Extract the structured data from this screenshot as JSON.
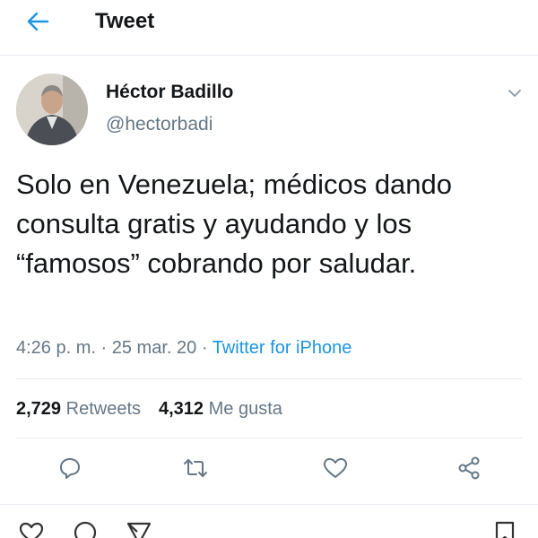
{
  "header": {
    "back_icon": "arrow-left-icon",
    "title": "Tweet"
  },
  "tweet": {
    "author": {
      "name": "Héctor Badillo",
      "handle": "@hectorbadi",
      "avatar_icon": "user-photo"
    },
    "text": "Solo en Venezuela; médicos dando consulta gratis y ayudando y los “famosos” cobrando por saludar.",
    "time": "4:26 p. m.",
    "date": "25 mar. 20",
    "separator": "·",
    "source": "Twitter for iPhone",
    "retweets_count": "2,729",
    "retweets_label": "Retweets",
    "likes_count": "4,312",
    "likes_label": "Me gusta"
  },
  "actions": [
    "reply-icon",
    "retweet-icon",
    "like-icon",
    "share-icon"
  ],
  "colors": {
    "accent": "#1b95e0",
    "text": "#14171a",
    "secondary": "#657786",
    "divider": "#e6ecf0"
  }
}
